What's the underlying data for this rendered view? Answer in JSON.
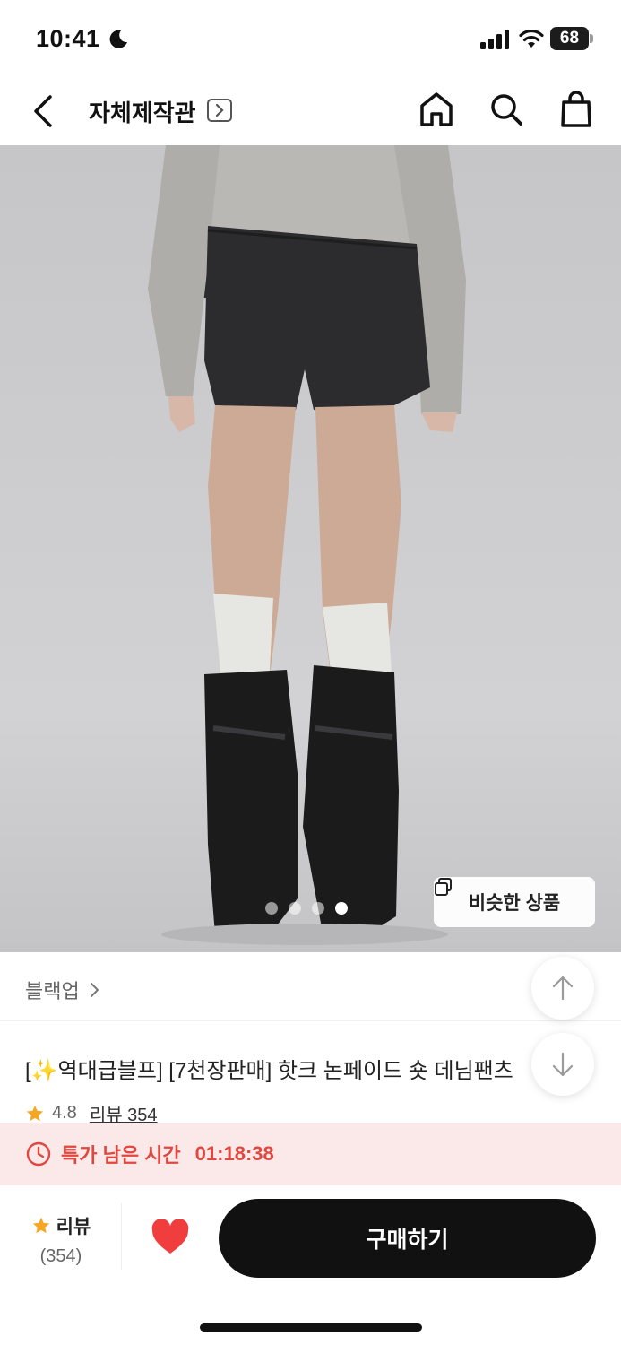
{
  "status_bar": {
    "time": "10:41",
    "battery": "68"
  },
  "header": {
    "store_name": "자체제작관"
  },
  "gallery": {
    "page_count": 4,
    "active_index": 3,
    "similar_label": "비슷한 상품"
  },
  "product": {
    "brand": "블랙업",
    "title": "[✨역대급블프] [7천장판매] 핫크 논페이드 숏 데님팬츠",
    "rating": "4.8",
    "review_label": "리뷰 354"
  },
  "deal": {
    "label": "특가 남은 시간",
    "time_left": "01:18:38"
  },
  "bottom_bar": {
    "review_label": "리뷰",
    "review_count": "(354)",
    "buy_label": "구매하기"
  },
  "colors": {
    "accent_red": "#e0473f",
    "star": "#f5a623",
    "heart": "#f03e3e",
    "primary_button": "#111111"
  },
  "icons": [
    "moon-icon",
    "signal-icon",
    "wifi-icon",
    "back-icon",
    "chevron-right-icon",
    "home-icon",
    "search-icon",
    "shopping-bag-icon",
    "copy-icon",
    "arrow-up-icon",
    "arrow-down-icon",
    "star-icon",
    "clock-icon",
    "heart-icon"
  ]
}
